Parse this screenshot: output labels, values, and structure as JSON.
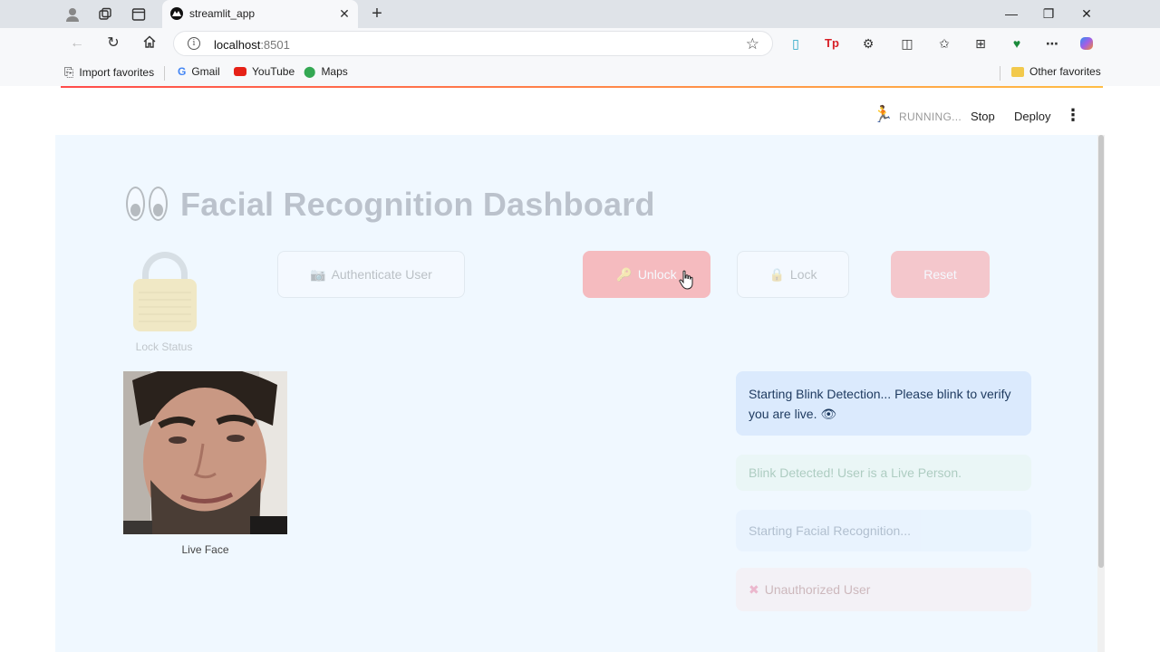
{
  "browser": {
    "tab_title": "streamlit_app",
    "address_host": "localhost",
    "address_port": ":8501",
    "bookmarks": [
      "Import favorites",
      "Gmail",
      "YouTube",
      "Maps"
    ],
    "other_favorites": "Other favorites"
  },
  "header": {
    "status": "RUNNING...",
    "stop_label": "Stop",
    "deploy_label": "Deploy"
  },
  "app": {
    "title": "Facial Recognition Dashboard",
    "lock_caption": "Lock Status",
    "buttons": {
      "authenticate": "Authenticate User",
      "unlock": "Unlock",
      "lock": "Lock",
      "reset": "Reset"
    },
    "face_caption": "Live Face",
    "alerts": {
      "blink_start": "Starting Blink Detection... Please blink to verify you are live. 👁",
      "blink_detected": "Blink Detected! User is a Live Person.",
      "facial_start": "Starting Facial Recognition...",
      "unauthorized": "Unauthorized User"
    }
  },
  "colors": {
    "primary": "#ff4b4b",
    "page_bg": "#f0f8ff",
    "info_bg": "#dbeafd",
    "success_bg": "#dff3e4",
    "error_bg": "#fde2e2"
  }
}
